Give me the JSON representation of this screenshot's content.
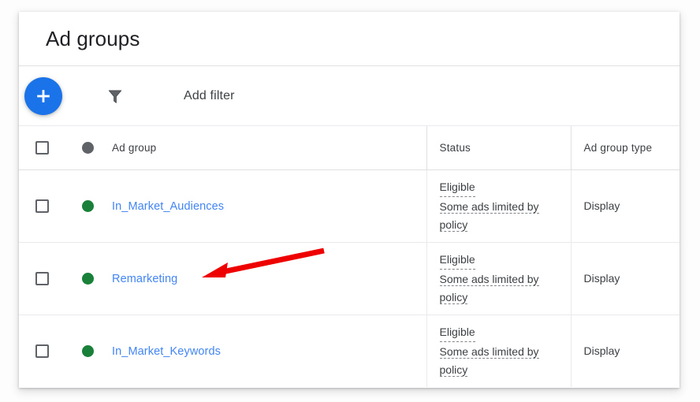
{
  "header": {
    "title": "Ad groups"
  },
  "toolbar": {
    "add_button_label": "+",
    "add_button_icon": "plus-icon",
    "filter_icon": "funnel-filter-icon",
    "add_filter_label": "Add filter"
  },
  "table": {
    "columns": [
      {
        "key": "select",
        "label": ""
      },
      {
        "key": "status_dot",
        "label": ""
      },
      {
        "key": "name",
        "label": "Ad group"
      },
      {
        "key": "status",
        "label": "Status"
      },
      {
        "key": "type",
        "label": "Ad group type"
      }
    ],
    "header": {
      "select_all_checkbox": "select-all-checkbox",
      "status_dot_icon": "status-dot-header",
      "name_label": "Ad group",
      "status_label": "Status",
      "type_label": "Ad group type"
    },
    "rows": [
      {
        "name": "In_Market_Audiences",
        "status_dot_color": "#188038",
        "status_primary": "Eligible",
        "status_secondary": "Some ads limited by policy",
        "type": "Display",
        "checked": false
      },
      {
        "name": "Remarketing",
        "status_dot_color": "#188038",
        "status_primary": "Eligible",
        "status_secondary": "Some ads limited by policy",
        "type": "Display",
        "checked": false
      },
      {
        "name": "In_Market_Keywords",
        "status_dot_color": "#188038",
        "status_primary": "Eligible",
        "status_secondary": "Some ads limited by policy",
        "type": "Display",
        "checked": false
      }
    ]
  },
  "annotation": {
    "arrow_color": "#EE0000",
    "arrow_points_to": "Remarketing"
  },
  "colors": {
    "accent_blue": "#1a73e8",
    "link_blue": "#4285f4",
    "status_green": "#188038",
    "header_dot_grey": "#5f6368",
    "text_primary": "#202124",
    "text_secondary": "#3c4043",
    "divider": "#e0e0e0"
  }
}
